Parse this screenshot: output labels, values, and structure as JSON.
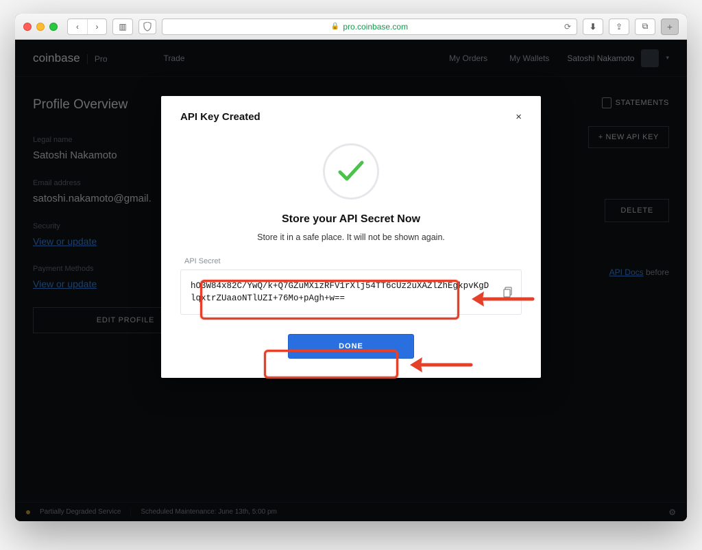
{
  "browser": {
    "url": "pro.coinbase.com"
  },
  "header": {
    "brand": "coinbase",
    "brand_suffix": "Pro",
    "nav_trade": "Trade",
    "nav_orders": "My Orders",
    "nav_wallets": "My Wallets",
    "user_name": "Satoshi Nakamoto"
  },
  "profile": {
    "page_title": "Profile Overview",
    "legal_name_label": "Legal name",
    "legal_name": "Satoshi Nakamoto",
    "email_label": "Email address",
    "email": "satoshi.nakamoto@gmail.",
    "security_label": "Security",
    "security_link": "View or update",
    "payment_label": "Payment Methods",
    "payment_link": "View or update",
    "edit_btn": "EDIT PROFILE"
  },
  "right": {
    "statements": "STATEMENTS",
    "new_key": "+ NEW API KEY",
    "delete": "DELETE",
    "docs_link": "API Docs",
    "docs_after": " before"
  },
  "status": {
    "service": "Partially Degraded Service",
    "maint": "Scheduled Maintenance: June 13th, 5:00 pm"
  },
  "modal": {
    "title": "API Key Created",
    "h2": "Store your API Secret Now",
    "sub": "Store it in a safe place. It will not be shown again.",
    "secret_label": "API Secret",
    "secret": "hO3W84x82C/YwQ/k+Q7GZuMXizRFV1rXlj54TT6cUz2uXAZlZhEgkpvKgDlqxtrZUaaoNTlUZI+76Mo+pAgh+w==",
    "done": "DONE"
  }
}
